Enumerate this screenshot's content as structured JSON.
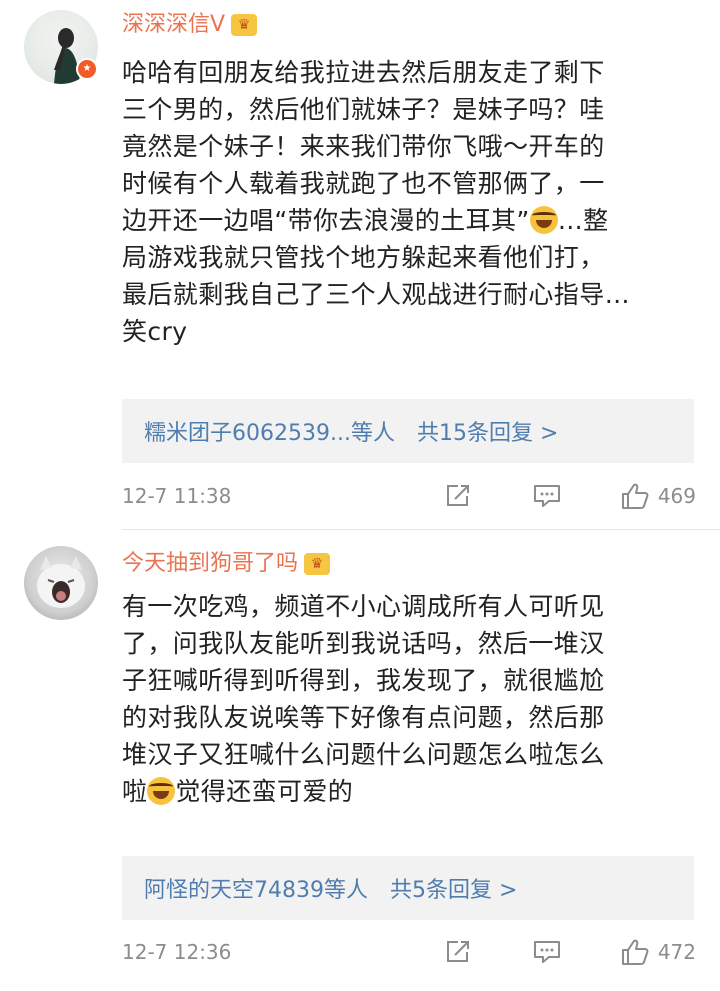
{
  "comments": [
    {
      "username": "深深深信V",
      "text_lines": [
        "哈哈有回朋友给我拉进去然后朋友走了剩下",
        "三个男的，然后他们就妹子？是妹子吗？哇",
        "竟然是个妹子！来来我们带你飞哦～开车的",
        "时候有个人载着我就跑了也不管那俩了，一",
        "边开还一边唱“带你去浪漫的土耳其”",
        "…整",
        "局游戏我就只管找个地方躲起来看他们打，",
        "最后就剩我自己了三个人观战进行耐心指导…",
        "笑cry"
      ],
      "reply_preview": {
        "user": "糯米团子6062539...等人",
        "count": "共15条回复 >"
      },
      "time": "12-7 11:38",
      "likes": "469"
    },
    {
      "username": "今天抽到狗哥了吗",
      "text_lines": [
        "有一次吃鸡，频道不小心调成所有人可听见",
        "了，问我队友能听到我说话吗，然后一堆汉",
        "子狂喊听得到听得到，我发现了，就很尴尬",
        "的对我队友说唉等下好像有点问题，然后那",
        "堆汉子又狂喊什么问题什么问题怎么啦怎么",
        "啦",
        "觉得还蛮可爱的"
      ],
      "reply_preview": {
        "user": "阿怪的天空74839等人",
        "count": "共5条回复 >"
      },
      "time": "12-7 12:36",
      "likes": "472"
    }
  ],
  "icons": {
    "repost": "share-square-icon",
    "comment": "comment-bubble-icon",
    "like": "thumbs-up-icon",
    "emoji": "laughing-crying-emoji-icon",
    "badge": "crown-badge-icon"
  },
  "colors": {
    "username": "#eb7350",
    "link": "#507daf",
    "meta": "#8c8c8c",
    "reply_bg": "#f2f2f2"
  }
}
